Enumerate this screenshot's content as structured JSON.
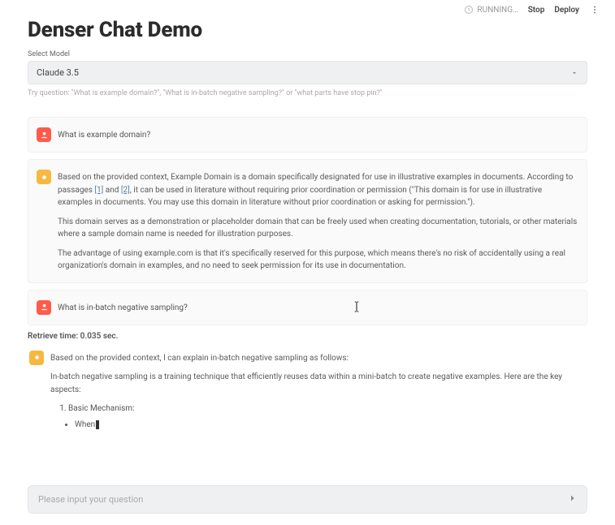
{
  "topbar": {
    "status": "RUNNING…",
    "stop": "Stop",
    "deploy": "Deploy"
  },
  "page": {
    "title": "Denser Chat Demo",
    "select_label": "Select Model",
    "model_value": "Claude 3.5",
    "hint": "Try question: \"What is example domain?\", \"What is in-batch negative sampling?\" or \"what parts have stop pin?\""
  },
  "chat": {
    "q1": "What is example domain?",
    "a1_p1_a": "Based on the provided context, Example Domain is a domain specifically designated for use in illustrative examples in documents. According to passages ",
    "a1_link1": "[1]",
    "a1_p1_b": " and ",
    "a1_link2": "[2]",
    "a1_p1_c": ", it can be used in literature without requiring prior coordination or permission (\"This domain is for use in illustrative examples in documents. You may use this domain in literature without prior coordination or asking for permission.\").",
    "a1_p2": "This domain serves as a demonstration or placeholder domain that can be freely used when creating documentation, tutorials, or other materials where a sample domain name is needed for illustration purposes.",
    "a1_p3": "The advantage of using example.com is that it's specifically reserved for this purpose, which means there's no risk of accidentally using a real organization's domain in examples, and no need to seek permission for its use in documentation.",
    "q2": "What is in-batch negative sampling?",
    "retrieve": "Retrieve time: 0.035 sec.",
    "a2_p1": "Based on the provided context, I can explain in-batch negative sampling as follows:",
    "a2_p2": "In-batch negative sampling is a training technique that efficiently reuses data within a mini-batch to create negative examples. Here are the key aspects:",
    "a2_li1": "Basic Mechanism:",
    "a2_bullet1": "When"
  },
  "input": {
    "placeholder": "Please input your question"
  }
}
